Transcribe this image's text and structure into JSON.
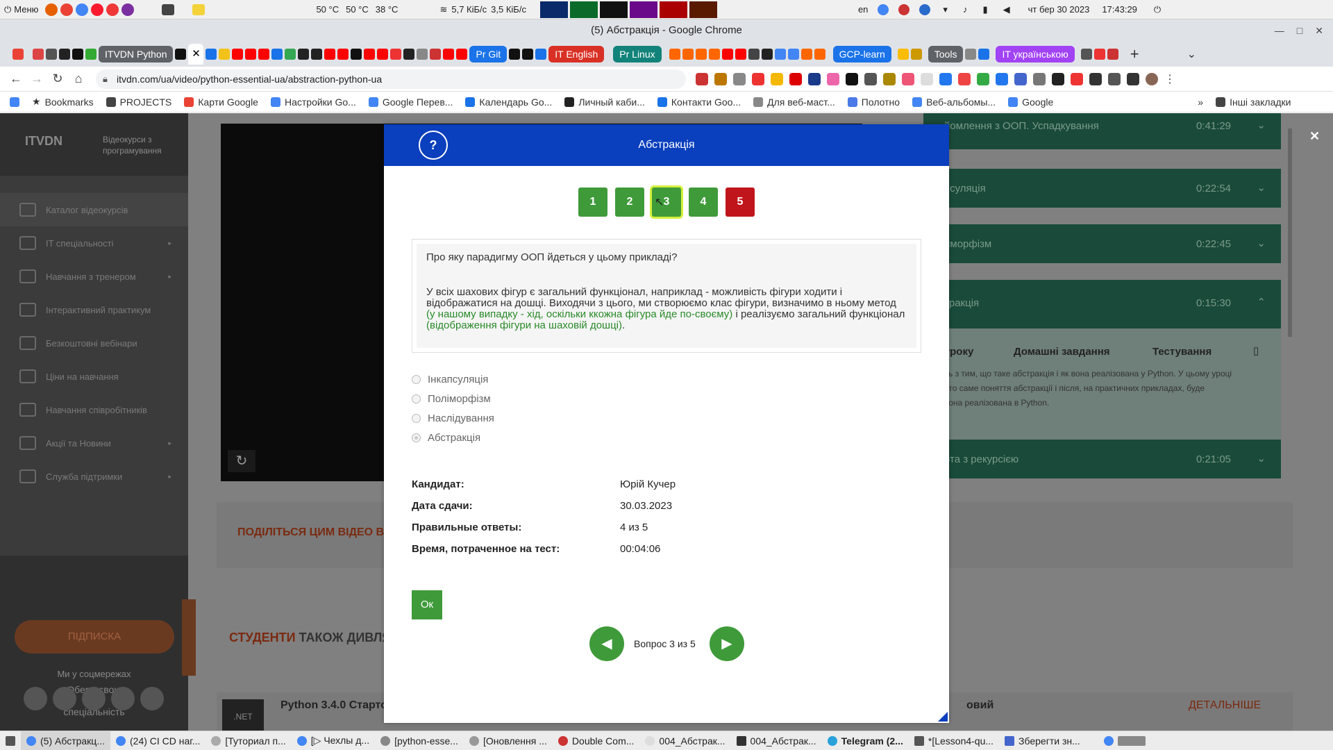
{
  "os_bar": {
    "menu_label": "Меню",
    "cpu1": "50 °C",
    "cpu2": "50 °C",
    "cpu3": "38 °C",
    "net": "5,7 КіБ/с",
    "net2": "3,5 КіБ/с",
    "lang": "en",
    "date": "чт бер 30 2023",
    "time": "17:43:29"
  },
  "window": {
    "title": "(5) Абстракція - Google Chrome"
  },
  "tabs": {
    "items": [
      {
        "label": "ITVDN Python",
        "color": "#5f6368"
      },
      {
        "label": "Pr Git",
        "color": "#1a73e8"
      },
      {
        "label": "IT English",
        "color": "#d93025"
      },
      {
        "label": "Pr Linux",
        "color": "#12837a"
      },
      {
        "label": "GCP-learn",
        "color": "#1a73e8"
      },
      {
        "label": "Tools",
        "color": "#5f6368"
      },
      {
        "label": "IT українською",
        "color": "#a142f4"
      }
    ],
    "active_close": "✕",
    "new_tab": "+"
  },
  "address": {
    "url": "itvdn.com/ua/video/python-essential-ua/abstraction-python-ua"
  },
  "bookmarks": {
    "items": [
      "Bookmarks",
      "PROJECTS",
      "Карти Google",
      "Настройки Go...",
      "Google Перев...",
      "Календарь Go...",
      "Личный каби...",
      "Контакти Goo...",
      "Для веб-маст...",
      "Полотно",
      "Веб-альбомы...",
      "Google"
    ],
    "more": "»",
    "other": "Інші закладки"
  },
  "sidebar": {
    "logo": "ITVDN",
    "tagline1": "Відеокурси з",
    "tagline2": "програмування",
    "items": [
      {
        "label": "Каталог відеокурсів",
        "arrow": ""
      },
      {
        "label": "IT спеціальності",
        "arrow": "▸"
      },
      {
        "label": "Навчання з тренером",
        "arrow": "▸"
      },
      {
        "label": "Інтерактивний практикум",
        "arrow": ""
      },
      {
        "label": "Безкоштовні вебінари",
        "arrow": ""
      },
      {
        "label": "Ціни на навчання",
        "arrow": ""
      },
      {
        "label": "Навчання співробітників",
        "arrow": ""
      },
      {
        "label": "Акції та Новини",
        "arrow": "▸"
      },
      {
        "label": "Служба підтримки",
        "arrow": "▸"
      }
    ],
    "choose1": "Обери свою",
    "choose2": "IT",
    "choose3": "спеціальність",
    "subscribe": "ПІДПИСКА",
    "social": "Ми у соцмережах"
  },
  "page": {
    "share": "ПОДІЛІТЬСЯ ЦИМ ВІДЕО В С",
    "students1": "СТУДЕНТИ",
    "students2": "ТАКОЖ ДИВЛЯ",
    "course1": "Python 3.4.0 Стартов",
    "course2": "овий",
    "details": "ДЕТАЛЬНІШЕ",
    "net_badge": ".NET"
  },
  "lessons": [
    {
      "title": "йомлення з ООП. Успадкування",
      "dur": "0:41:29"
    },
    {
      "title": "псуляція",
      "dur": "0:22:54"
    },
    {
      "title": "иморфізм",
      "dur": "0:22:45"
    },
    {
      "title": "тракція",
      "dur": "0:15:30"
    },
    {
      "title": "ота з рекурсією",
      "dur": "0:21:05"
    }
  ],
  "lesson_tabs": {
    "a": "уроку",
    "b": "Домашні завдання",
    "c": "Тестування"
  },
  "lesson_desc": [
    "сь з тим, що таке абстракція і як вона реалізована у Python. У цьому уроці",
    "ото саме поняття абстракції і після, на практичних прикладах, буде",
    "вона реалізована в Python."
  ],
  "modal": {
    "help": "?",
    "title": "Абстракція",
    "questions": [
      {
        "n": "1",
        "state": "ok"
      },
      {
        "n": "2",
        "state": "ok"
      },
      {
        "n": "3",
        "state": "current"
      },
      {
        "n": "4",
        "state": "ok"
      },
      {
        "n": "5",
        "state": "wrong"
      }
    ],
    "question": "Про яку парадигму ООП йдеться у цьому прикладі?",
    "body_1": "У всіх шахових фігур є загальний функціонал, наприклад - можливість фігури ходити і відображатися на дошці. Виходячи з цього, ми створюємо  клас фігури, визначимо в ньому метод ",
    "body_green1": "(у нашому випадку - хід, оскільки ккожна фігура йде по-своєму)",
    "body_2": " і реалізуємо загальний функціонал ",
    "body_green2": "(відображення фігури на шаховій дошці)",
    "body_3": ".",
    "options": [
      "Інкапсуляція",
      "Поліморфізм",
      "Наслідування",
      "Абстракція"
    ],
    "selected": "Абстракція",
    "info": [
      {
        "k": "Кандидат:",
        "v": "Юрій Кучер"
      },
      {
        "k": "Дата сдачи:",
        "v": "30.03.2023"
      },
      {
        "k": "Правильные ответы:",
        "v": "4 из 5"
      },
      {
        "k": "Время, потраченное на тест:",
        "v": "00:04:06"
      }
    ],
    "ok": "Ок",
    "counter": "Вопрос  3  из  5"
  },
  "taskbar": {
    "items": [
      "(5) Абстракц...",
      "(24) CI CD наг...",
      "[Туториал п...",
      "[▷ Чехлы д...",
      "[python-esse...",
      "[Оновлення ...",
      "Double Com...",
      "004_Абстрак...",
      "004_Абстрак...",
      "Telegram (2...",
      "*[Lesson4-qu...",
      "Зберегти зн..."
    ]
  }
}
